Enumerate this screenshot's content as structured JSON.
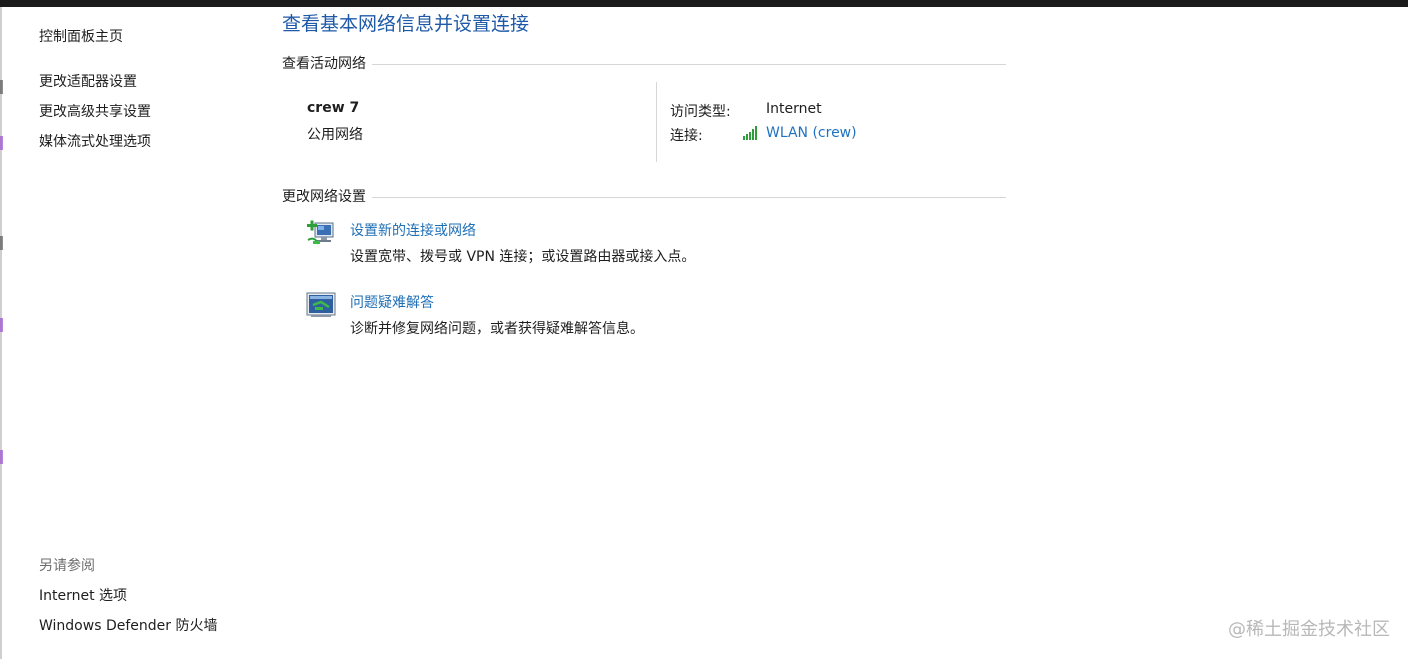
{
  "sidebar": {
    "control_panel_home": "控制面板主页",
    "links": [
      "更改适配器设置",
      "更改高级共享设置",
      "媒体流式处理选项"
    ],
    "see_also_title": "另请参阅",
    "see_also": [
      "Internet 选项",
      "Windows Defender 防火墙"
    ]
  },
  "main": {
    "title": "查看基本网络信息并设置连接",
    "active_networks": {
      "heading": "查看活动网络",
      "network_name": "crew 7",
      "network_category": "公用网络",
      "access_type_label": "访问类型:",
      "access_type_value": "Internet",
      "connections_label": "连接:",
      "connection_link": "WLAN (crew)",
      "connection_icon": "wifi-signal-icon"
    },
    "change_settings": {
      "heading": "更改网络设置",
      "tasks": [
        {
          "icon": "new-connection-icon",
          "title": "设置新的连接或网络",
          "description": "设置宽带、拨号或 VPN 连接；或设置路由器或接入点。"
        },
        {
          "icon": "troubleshoot-icon",
          "title": "问题疑难解答",
          "description": "诊断并修复网络问题，或者获得疑难解答信息。"
        }
      ]
    }
  },
  "watermark": "@稀土掘金技术社区",
  "colors": {
    "title": "#1e5aa8",
    "link": "#1f6fb5",
    "topbar": "#1b1b1b",
    "signal": "#2e9e3a"
  }
}
